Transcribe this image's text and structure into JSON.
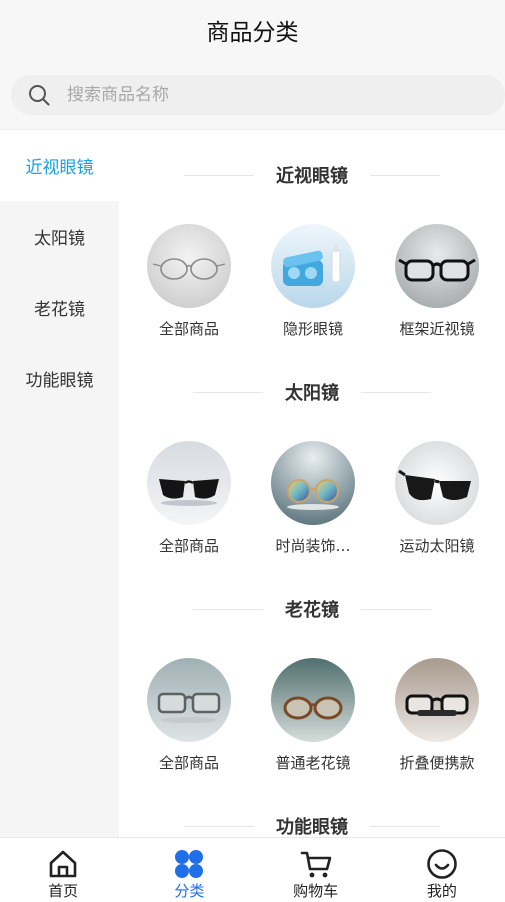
{
  "header": {
    "title": "商品分类"
  },
  "search": {
    "placeholder": "搜索商品名称"
  },
  "sidebar": {
    "items": [
      {
        "label": "近视眼镜",
        "active": true
      },
      {
        "label": "太阳镜",
        "active": false
      },
      {
        "label": "老花镜",
        "active": false
      },
      {
        "label": "功能眼镜",
        "active": false
      }
    ]
  },
  "sections": [
    {
      "title": "近视眼镜",
      "products": [
        {
          "label": "全部商品",
          "image": "frame-glasses-thin"
        },
        {
          "label": "隐形眼镜",
          "image": "contact-lens-case"
        },
        {
          "label": "框架近视镜",
          "image": "black-frame-glasses"
        }
      ]
    },
    {
      "title": "太阳镜",
      "products": [
        {
          "label": "全部商品",
          "image": "black-sunglasses"
        },
        {
          "label": "时尚装饰…",
          "image": "mirrored-sunglasses"
        },
        {
          "label": "运动太阳镜",
          "image": "sport-sunglasses"
        }
      ]
    },
    {
      "title": "老花镜",
      "products": [
        {
          "label": "全部商品",
          "image": "gray-reading-glasses"
        },
        {
          "label": "普通老花镜",
          "image": "tortoise-reading-glasses"
        },
        {
          "label": "折叠便携款",
          "image": "folding-reading-glasses"
        }
      ]
    },
    {
      "title": "功能眼镜",
      "products": []
    }
  ],
  "tabbar": {
    "items": [
      {
        "label": "首页",
        "icon": "home-icon",
        "active": false
      },
      {
        "label": "分类",
        "icon": "category-icon",
        "active": true
      },
      {
        "label": "购物车",
        "icon": "cart-icon",
        "active": false
      },
      {
        "label": "我的",
        "icon": "profile-icon",
        "active": false
      }
    ]
  },
  "colors": {
    "accent_sidebar": "#1aa0e0",
    "accent_tab": "#1e6fe8"
  }
}
